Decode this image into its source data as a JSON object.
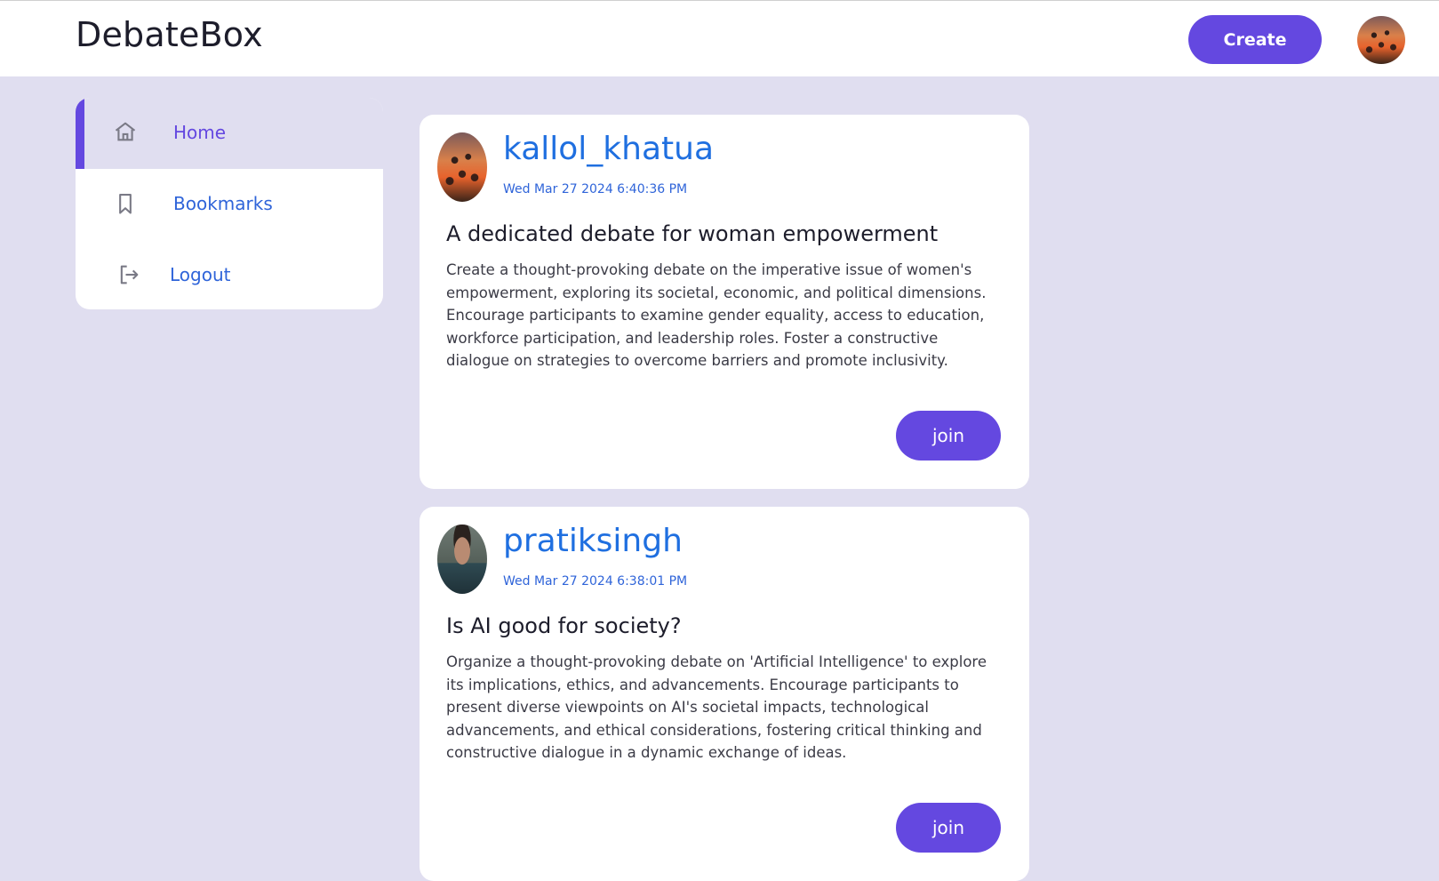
{
  "header": {
    "brand": "DebateBox",
    "create_label": "Create",
    "avatar_icon": "user-avatar-sunset"
  },
  "sidebar": {
    "items": [
      {
        "label": "Home",
        "icon": "home-icon",
        "active": true
      },
      {
        "label": "Bookmarks",
        "icon": "bookmark-icon",
        "active": false
      },
      {
        "label": "Logout",
        "icon": "logout-icon",
        "active": false
      }
    ]
  },
  "posts": [
    {
      "username": "kallol_khatua",
      "timestamp": "Wed Mar 27 2024 6:40:36 PM",
      "title": "A dedicated debate for woman empowerment",
      "body": "Create a thought-provoking debate on the imperative issue of women's empowerment, exploring its societal, economic, and political dimensions. Encourage participants to examine gender equality, access to education, workforce participation, and leadership roles. Foster a constructive dialogue on strategies to overcome barriers and promote inclusivity.",
      "join_label": "join"
    },
    {
      "username": "pratiksingh",
      "timestamp": "Wed Mar 27 2024 6:38:01 PM",
      "title": "Is AI good for society?",
      "body": "Organize a thought-provoking debate on 'Artificial Intelligence' to explore its implications, ethics, and advancements. Encourage participants to present diverse viewpoints on AI's societal impacts, technological advancements, and ethical considerations, fostering critical thinking and constructive dialogue in a dynamic exchange of ideas.",
      "join_label": "join"
    }
  ],
  "colors": {
    "accent": "#6448e0",
    "link": "#1f6fe0",
    "background": "#e0def0"
  }
}
